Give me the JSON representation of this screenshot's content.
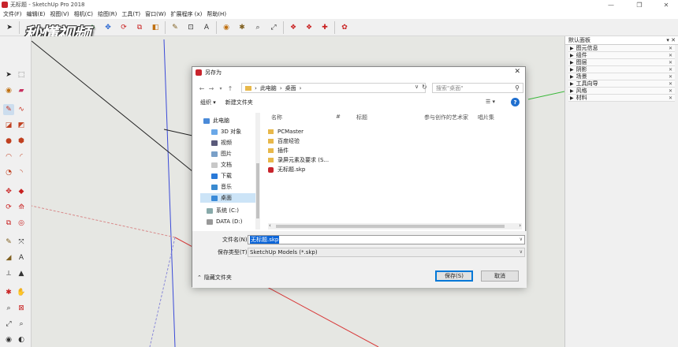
{
  "window": {
    "title": "无标题 - SketchUp Pro 2018",
    "minimize": "—",
    "maximize": "❐",
    "close": "✕"
  },
  "menu": [
    "文件(F)",
    "编辑(E)",
    "视图(V)",
    "相机(C)",
    "绘图(R)",
    "工具(T)",
    "窗口(W)",
    "扩展程序 (x)",
    "帮助(H)"
  ],
  "watermark": "秒懂视频",
  "tray": {
    "title": "默认面板",
    "controls": "▾ ✕",
    "panels": [
      "图元信息",
      "组件",
      "图层",
      "阴影",
      "场景",
      "工具向导",
      "风格",
      "材料"
    ]
  },
  "dialog": {
    "title": "另存为",
    "close": "✕",
    "breadcrumb": [
      "此电脑",
      "桌面"
    ],
    "search_placeholder": "搜索\"桌面\"",
    "organize": "组织 ▾",
    "new_folder": "新建文件夹",
    "columns": [
      "名称",
      "#",
      "标题",
      "参与创作的艺术家",
      "唱片集"
    ],
    "nav_items": [
      {
        "label": "此电脑",
        "icon": "computer-icon"
      },
      {
        "label": "3D 对象",
        "icon": "3d-objects-icon"
      },
      {
        "label": "视频",
        "icon": "video-icon"
      },
      {
        "label": "图片",
        "icon": "pictures-icon"
      },
      {
        "label": "文档",
        "icon": "documents-icon"
      },
      {
        "label": "下载",
        "icon": "download-icon"
      },
      {
        "label": "音乐",
        "icon": "music-icon"
      },
      {
        "label": "桌面",
        "icon": "desktop-icon"
      },
      {
        "label": "系统 (C:)",
        "icon": "drive-icon"
      },
      {
        "label": "DATA (D:)",
        "icon": "drive-icon"
      }
    ],
    "files": [
      {
        "name": "PCMaster",
        "type": "folder"
      },
      {
        "name": "百度经验",
        "type": "folder"
      },
      {
        "name": "插件",
        "type": "folder"
      },
      {
        "name": "录屏元素及要求 (S...",
        "type": "folder"
      },
      {
        "name": "无标题.skp",
        "type": "skp"
      }
    ],
    "filename_label": "文件名(N):",
    "filename_value": "无标题.skp",
    "filetype_label": "保存类型(T):",
    "filetype_value": "SketchUp Models (*.skp)",
    "hide_folders": "隐藏文件夹",
    "save_button": "保存(S)",
    "cancel_button": "取消"
  },
  "colors": {
    "accent": "#0078d7",
    "sketchup_red": "#c8242c",
    "folder": "#e8b84a",
    "canvas": "#e6e7e3"
  }
}
